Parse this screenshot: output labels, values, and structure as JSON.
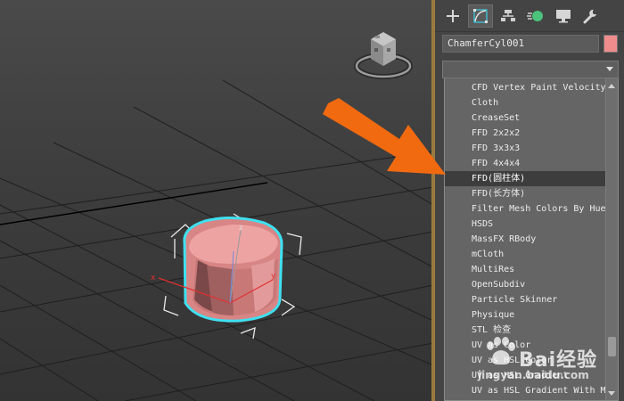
{
  "viewport": {
    "gizmo_axes": {
      "z": "z",
      "x": "x",
      "y": "y"
    }
  },
  "command_panel": {
    "tabs": [
      {
        "name": "create",
        "icon": "plus-icon"
      },
      {
        "name": "modify",
        "icon": "modify-curve-icon",
        "active": true
      },
      {
        "name": "hierarchy",
        "icon": "hierarchy-icon"
      },
      {
        "name": "motion",
        "icon": "motion-icon"
      },
      {
        "name": "display",
        "icon": "display-monitor-icon"
      },
      {
        "name": "utilities",
        "icon": "wrench-icon"
      }
    ],
    "object_name": "ChamferCyl001",
    "object_color": "#f08c8c",
    "modifier_list": {
      "selected_value": "",
      "items": [
        "CFD Vertex Paint Velocity",
        "Cloth",
        "CreaseSet",
        "FFD 2x2x2",
        "FFD 3x3x3",
        "FFD 4x4x4",
        "FFD(圆柱体)",
        "FFD(长方体)",
        "Filter Mesh Colors By Hue",
        "HSDS",
        "MassFX RBody",
        "mCloth",
        "MultiRes",
        "OpenSubdiv",
        "Particle Skinner",
        "Physique",
        "STL 检查",
        "UV as Color",
        "UV as HSL Color",
        "UV as HSL Gradient",
        "UV as HSL Gradient With M"
      ],
      "highlighted_index": 6
    }
  },
  "overlay": {
    "arrow_color": "#f26a10",
    "watermark_brand": "Bai经验",
    "watermark_url": "jingyan.baidu.com"
  },
  "colors": {
    "selection_outline": "#3fe0f0",
    "object_fill": "#e69090",
    "panel_border": "#9a7a3e"
  }
}
